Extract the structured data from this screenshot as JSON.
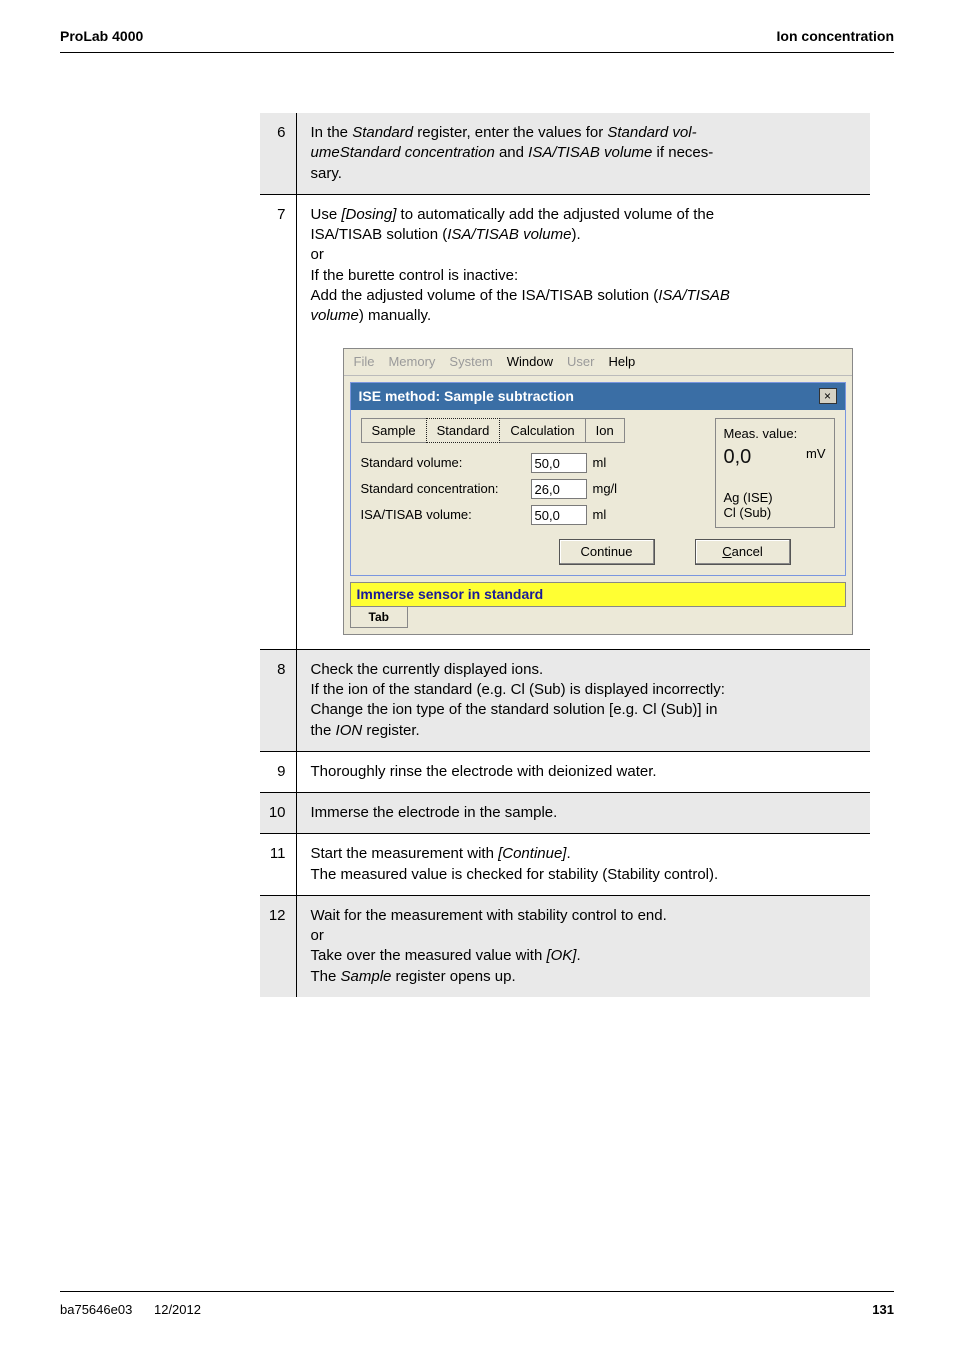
{
  "header": {
    "left": "ProLab 4000",
    "right": "Ion concentration"
  },
  "steps": {
    "s6": {
      "num": "6",
      "p1a": "In the ",
      "p1b": "Standard",
      "p1c": " register, enter the values for ",
      "p1d": "Standard vol-",
      "p1e": "ume",
      "p1f": "Standard concentration",
      "p1g": " and ",
      "p1h": "ISA/TISAB volume",
      "p1i": " if neces-",
      "p1j": "sary."
    },
    "s7": {
      "num": "7",
      "l1a": "Use ",
      "l1b": "[Dosing]",
      "l1c": " to automatically add the adjusted volume of the",
      "l2a": "ISA/TISAB solution (",
      "l2b": "ISA/TISAB volume",
      "l2c": ").",
      "l3": "or",
      "l4": "If the burette control is inactive:",
      "l5a": "Add the adjusted volume of the ISA/TISAB solution (",
      "l5b": "ISA/TISAB",
      "l5c": "",
      "l6a": "volume",
      "l6b": ") manually."
    },
    "s8": {
      "num": "8",
      "l1": "Check the currently displayed ions.",
      "l2": "If the ion of the standard (e.g. Cl (Sub) is displayed incorrectly:",
      "l3": "Change the ion type of the standard solution [e.g. Cl (Sub)] in",
      "l4a": "the ",
      "l4b": "ION",
      "l4c": " register."
    },
    "s9": {
      "num": "9",
      "l1": "Thoroughly rinse the electrode with deionized water."
    },
    "s10": {
      "num": "10",
      "l1": "Immerse the electrode in the sample."
    },
    "s11": {
      "num": "11",
      "l1a": "Start the measurement with ",
      "l1b": "[Continue]",
      "l1c": ".",
      "l2": "The measured value is checked for stability (Stability control)."
    },
    "s12": {
      "num": "12",
      "l1": "Wait for the measurement with stability control to end.",
      "l2": "or",
      "l3a": "Take over the measured value with ",
      "l3b": "[OK]",
      "l3c": ".",
      "l4a": "The ",
      "l4b": "Sample",
      "l4c": " register opens up."
    }
  },
  "dialog": {
    "menu": {
      "file": "File",
      "memory": "Memory",
      "system": "System",
      "window": "Window",
      "user": "User",
      "help": "Help"
    },
    "title": "ISE method:  Sample subtraction",
    "close": "×",
    "tabs": {
      "sample": "Sample",
      "standard": "Standard",
      "calculation": "Calculation",
      "ion": "Ion"
    },
    "fields": {
      "stdvol_label": "Standard volume:",
      "stdvol_value": "50,0",
      "stdvol_unit": "ml",
      "stdconc_label": "Standard concentration:",
      "stdconc_value": "26,0",
      "stdconc_unit": "mg/l",
      "isa_label": "ISA/TISAB volume:",
      "isa_value": "50,0",
      "isa_unit": "ml"
    },
    "meas": {
      "label": "Meas. value:",
      "value": "0,0",
      "unit": "mV",
      "line1": "Ag (ISE)",
      "line2": "Cl (Sub)"
    },
    "buttons": {
      "continue": "Continue",
      "cancel_pre": "C",
      "cancel_rest": "ancel"
    },
    "status": "Immerse sensor in standard",
    "tab_footer": "Tab"
  },
  "footer": {
    "left1": "ba75646e03",
    "left2": "12/2012",
    "right": "131"
  }
}
